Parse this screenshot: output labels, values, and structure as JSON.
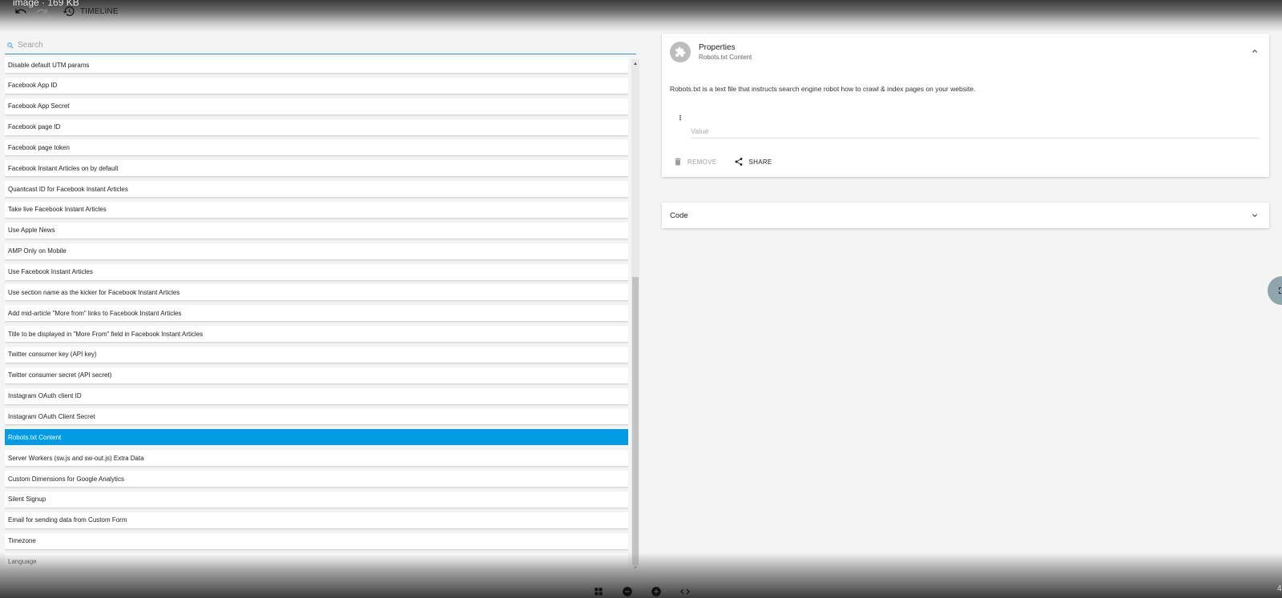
{
  "top_bar": {
    "file_title": "image · 169 KB",
    "timeline_label": "TIMELINE"
  },
  "search": {
    "placeholder": "Search"
  },
  "list": {
    "items": [
      "Disable default UTM params",
      "Facebook App ID",
      "Facebook App Secret",
      "Facebook page ID",
      "Facebook page token",
      "Facebook Instant Articles on by default",
      "Quantcast ID for Facebook Instant Articles",
      "Take live Facebook Instant Articles",
      "Use Apple News",
      "AMP Only on Mobile",
      "Use Facebook Instant Articles",
      "Use section name as the kicker for Facebook Instant Articles",
      "Add mid-article \"More from\" links to Facebook Instant Articles",
      "Title to be displayed in \"More From\" field in Facebook Instant Articles",
      "Twitter consumer key (API key)",
      "Twitter consumer secret (API secret)",
      "Instagram OAuth client ID",
      "Instagram OAuth Client Secret",
      "Robots.txt Content",
      "Server Workers (sw.js and sw-out.js) Extra Data",
      "Custom Dimensions for Google Analytics",
      "Silent Signup",
      "Email for sending data from Custom Form",
      "Timezone",
      "Language"
    ],
    "selected_index": 18
  },
  "properties": {
    "title": "Properties",
    "subtitle": "Robots.txt Content",
    "description": "Robots.txt is a text file that instructs search engine robot how to crawl & index pages on your website.",
    "value_placeholder": "Value",
    "remove_label": "REMOVE",
    "share_label": "SHARE"
  },
  "code": {
    "title": "Code"
  },
  "page_number": "4",
  "colors": {
    "accent": "#2196f3",
    "selected": "#039be5"
  }
}
